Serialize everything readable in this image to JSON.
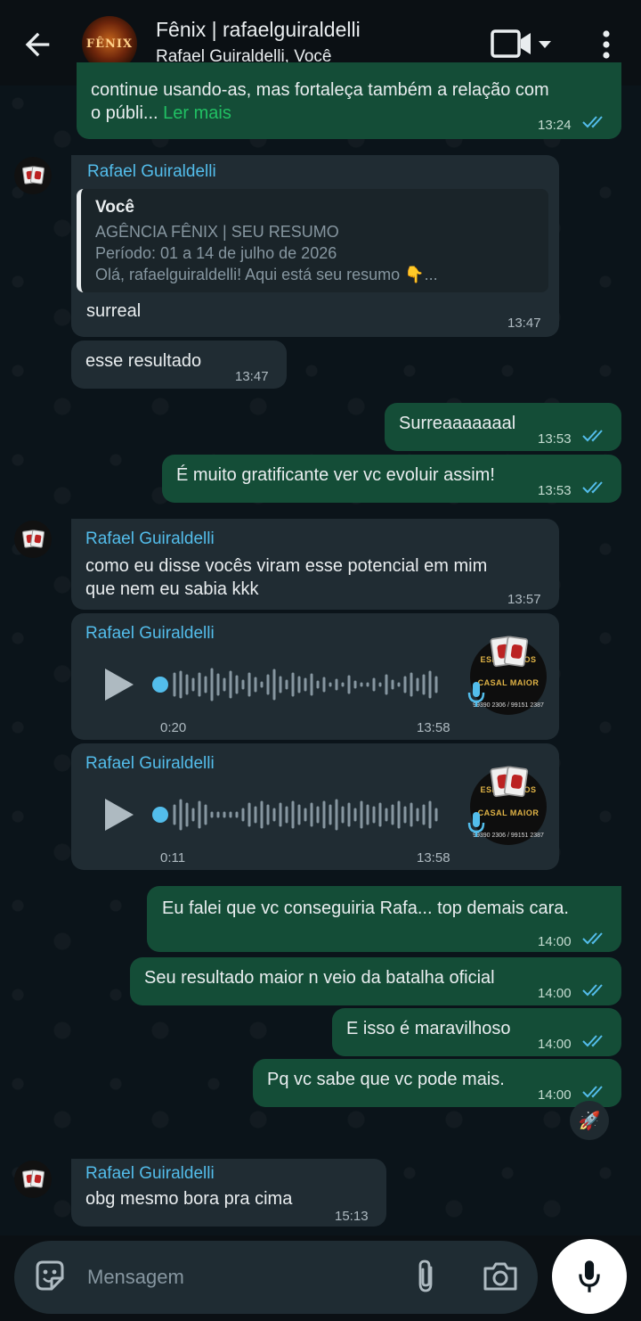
{
  "header": {
    "title": "Fênix | rafaelguiraldelli",
    "subtitle": "Rafael Guiraldelli, Você",
    "avatar_text": "FÊNIX"
  },
  "messages": {
    "m0": {
      "text": "continue usando-as, mas fortaleça também a relação com",
      "text2": "o públi...",
      "read_more": "Ler mais",
      "time": "13:24"
    },
    "m1": {
      "sender": "Rafael Guiraldelli",
      "quote_author": "Você",
      "quote_l1": "AGÊNCIA FÊNIX | SEU RESUMO",
      "quote_l2": "Período: 01 a 14 de julho de 2026",
      "quote_l3": "Olá, rafaelguiraldelli! Aqui está seu resumo 👇...",
      "text": "surreal",
      "time": "13:47"
    },
    "m2": {
      "text": "esse resultado",
      "time": "13:47"
    },
    "m3": {
      "text": "Surreaaaaaaal",
      "time": "13:53"
    },
    "m4": {
      "text": "É muito gratificante ver vc evoluir assim!",
      "time": "13:53"
    },
    "m5": {
      "sender": "Rafael Guiraldelli",
      "text": "como eu disse vocês viram esse potencial em mim",
      "text2": "que nem eu sabia kkk",
      "time": "13:57"
    },
    "m6": {
      "sender": "Rafael Guiraldelli",
      "duration": "0:20",
      "time": "13:58",
      "avatar_brand": "ESPETINHOS",
      "avatar_brand2": "CASAL MAIOR",
      "avatar_phone": "99390 2306 / 99151 2387"
    },
    "m7": {
      "sender": "Rafael Guiraldelli",
      "duration": "0:11",
      "time": "13:58",
      "avatar_brand": "ESPETINHOS",
      "avatar_brand2": "CASAL MAIOR",
      "avatar_phone": "99390 2306 / 99151 2387"
    },
    "m8": {
      "text": "Eu falei que vc conseguiria Rafa... top demais cara.",
      "time": "14:00"
    },
    "m9": {
      "text": "Seu resultado maior n veio da batalha oficial",
      "time": "14:00"
    },
    "m10": {
      "text": "E isso é maravilhoso",
      "time": "14:00"
    },
    "m11": {
      "text": "Pq vc sabe que vc pode mais.",
      "time": "14:00"
    },
    "m12": {
      "sender": "Rafael Guiraldelli",
      "text": "obg mesmo bora pra cima",
      "time": "15:13"
    }
  },
  "reaction": {
    "icon": "rocket-icon",
    "glyph": "🚀"
  },
  "composer": {
    "placeholder": "Mensagem"
  },
  "colors": {
    "outgoing": "#144d37",
    "incoming": "#202c33",
    "accent": "#21c063",
    "sender": "#53bdeb",
    "ticks": "#53bdeb"
  }
}
